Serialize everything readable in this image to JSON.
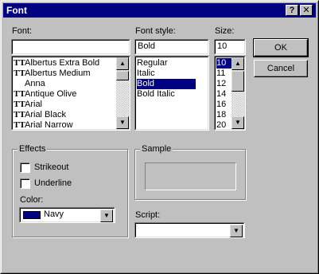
{
  "window": {
    "title": "Font",
    "help_button": "?",
    "close_button": "✕"
  },
  "font": {
    "label": "Font:",
    "value": "",
    "items": [
      {
        "label": "Albertus Extra Bold",
        "truetype": true
      },
      {
        "label": "Albertus Medium",
        "truetype": true
      },
      {
        "label": "Anna",
        "truetype": false
      },
      {
        "label": "Antique Olive",
        "truetype": true
      },
      {
        "label": "Arial",
        "truetype": true
      },
      {
        "label": "Arial Black",
        "truetype": true
      },
      {
        "label": "Arial Narrow",
        "truetype": true
      }
    ]
  },
  "font_style": {
    "label": "Font style:",
    "value": "Bold",
    "items": [
      "Regular",
      "Italic",
      "Bold",
      "Bold Italic"
    ],
    "selected": "Bold"
  },
  "size": {
    "label": "Size:",
    "value": "10",
    "items": [
      "10",
      "11",
      "12",
      "14",
      "16",
      "18",
      "20"
    ],
    "selected": "10"
  },
  "buttons": {
    "ok": "OK",
    "cancel": "Cancel"
  },
  "effects": {
    "title": "Effects",
    "strikeout": "Strikeout",
    "underline": "Underline",
    "strikeout_checked": false,
    "underline_checked": false,
    "color_label": "Color:",
    "color_value": "Navy",
    "color_swatch": "#000080"
  },
  "sample": {
    "title": "Sample"
  },
  "script": {
    "label": "Script:",
    "value": ""
  },
  "icons": {
    "truetype": "TT",
    "up_arrow": "▲",
    "down_arrow": "▼"
  },
  "colors": {
    "titlebar": "#000080",
    "selection": "#000080",
    "face": "#c0c0c0"
  }
}
